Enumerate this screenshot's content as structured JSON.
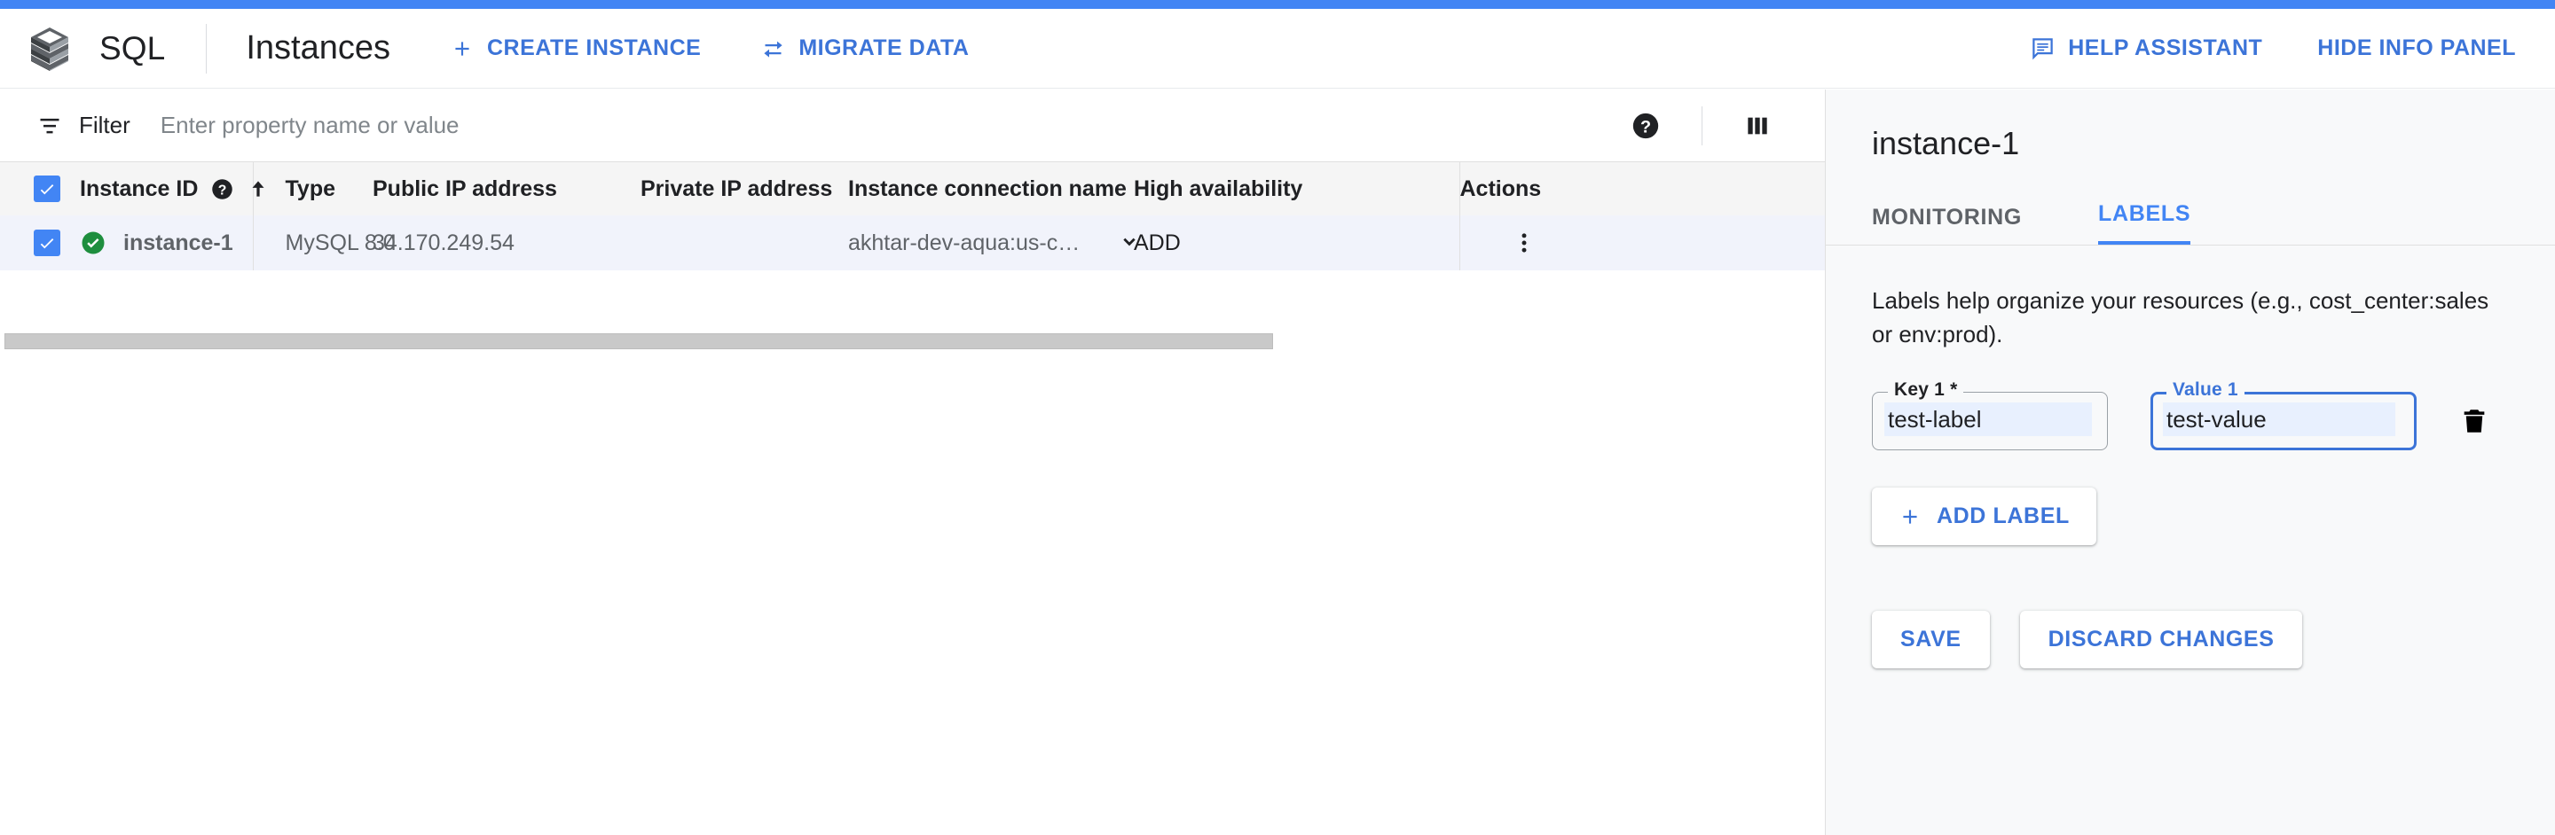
{
  "header": {
    "product_name": "SQL",
    "page_title": "Instances",
    "create_instance": "CREATE INSTANCE",
    "migrate_data": "MIGRATE DATA",
    "help_assistant": "HELP ASSISTANT",
    "hide_info_panel": "HIDE INFO PANEL",
    "accent_color": "#4285f4",
    "link_color": "#3c74d8"
  },
  "filter": {
    "label": "Filter",
    "placeholder": "Enter property name or value",
    "value": ""
  },
  "table": {
    "columns": [
      "Instance ID",
      "Type",
      "Public IP address",
      "Private IP address",
      "Instance connection name",
      "High availability",
      "Actions"
    ],
    "sort_column": "Instance ID",
    "sort_direction": "ascending",
    "rows": [
      {
        "selected": true,
        "status": "running",
        "instance_id": "instance-1",
        "type": "MySQL 8.0",
        "public_ip": "34.170.249.54",
        "private_ip": "",
        "connection_name": "akhtar-dev-aqua:us-c…",
        "high_availability": "ADD"
      }
    ]
  },
  "info_panel": {
    "title": "instance-1",
    "tabs": [
      {
        "label": "MONITORING",
        "active": false
      },
      {
        "label": "LABELS",
        "active": true
      }
    ],
    "description": "Labels help organize your resources (e.g., cost_center:sales or env:prod).",
    "labels": [
      {
        "key_label": "Key 1 *",
        "key_value": "test-label",
        "value_label": "Value 1",
        "value_value": "test-value"
      }
    ],
    "add_label": "ADD LABEL",
    "save": "SAVE",
    "discard": "DISCARD CHANGES"
  },
  "icons": {
    "logo": "sql-stack-icon",
    "plus": "plus-icon",
    "migrate": "swap-arrows-icon",
    "help_assistant": "comment-icon",
    "filter": "filter-icon",
    "help": "help-circle-icon",
    "columns": "column-display-icon",
    "sort_arrow": "arrow-up-icon",
    "status": "check-circle-icon",
    "chevron": "chevron-down-icon",
    "more": "more-vert-icon",
    "delete": "trash-icon"
  }
}
